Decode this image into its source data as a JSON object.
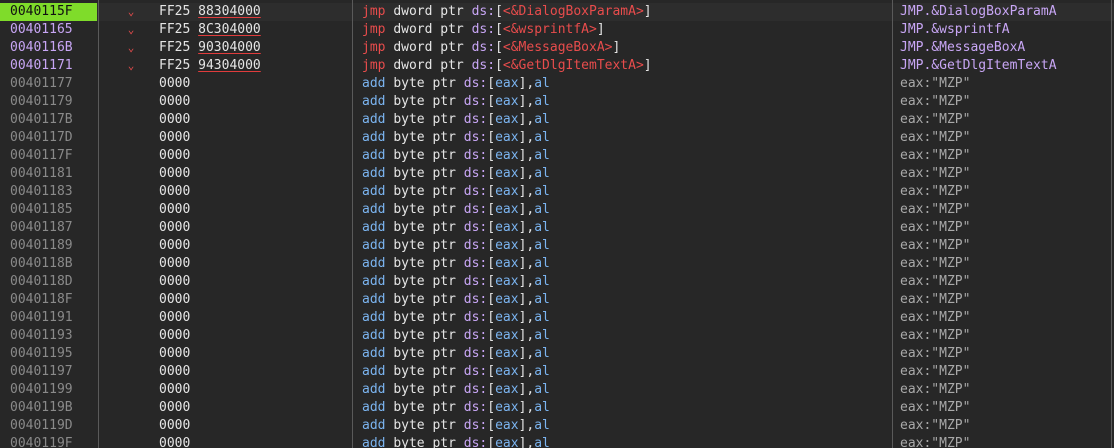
{
  "colors": {
    "background": "#272727",
    "eip_highlight": "#7fdc2a",
    "address_active": "#c8a6f5",
    "address_plain": "#8a8a8a",
    "jmp_mnemonic": "#e84c4c",
    "add_mnemonic": "#7bb4f0",
    "separator": "#5a5a5a"
  },
  "icons": {
    "jump_marker": "chevron-down-icon"
  },
  "jumps": [
    {
      "addr": "0040115F",
      "arrow": "⌄",
      "opcode": "FF25",
      "target": "88304000",
      "mnemonic": "jmp",
      "size": "dword ptr",
      "seg": "ds:",
      "symbol": "<&DialogBoxParamA>",
      "comment": "JMP.&DialogBoxParamA"
    },
    {
      "addr": "00401165",
      "arrow": "⌄",
      "opcode": "FF25",
      "target": "8C304000",
      "mnemonic": "jmp",
      "size": "dword ptr",
      "seg": "ds:",
      "symbol": "<&wsprintfA>",
      "comment": "JMP.&wsprintfA"
    },
    {
      "addr": "0040116B",
      "arrow": "⌄",
      "opcode": "FF25",
      "target": "90304000",
      "mnemonic": "jmp",
      "size": "dword ptr",
      "seg": "ds:",
      "symbol": "<&MessageBoxA>",
      "comment": "JMP.&MessageBoxA"
    },
    {
      "addr": "00401171",
      "arrow": "⌄",
      "opcode": "FF25",
      "target": "94304000",
      "mnemonic": "jmp",
      "size": "dword ptr",
      "seg": "ds:",
      "symbol": "<&GetDlgItemTextA>",
      "comment": "JMP.&GetDlgItemTextA"
    }
  ],
  "fill": {
    "bytes": "0000",
    "mnemonic": "add",
    "size": "byte ptr",
    "seg": "ds:",
    "mem": "eax",
    "reg": "al",
    "comment": "eax:\"MZP\"",
    "addresses": [
      "00401177",
      "00401179",
      "0040117B",
      "0040117D",
      "0040117F",
      "00401181",
      "00401183",
      "00401185",
      "00401187",
      "00401189",
      "0040118B",
      "0040118D",
      "0040118F",
      "00401191",
      "00401193",
      "00401195",
      "00401197",
      "00401199",
      "0040119B",
      "0040119D",
      "0040119F"
    ]
  }
}
